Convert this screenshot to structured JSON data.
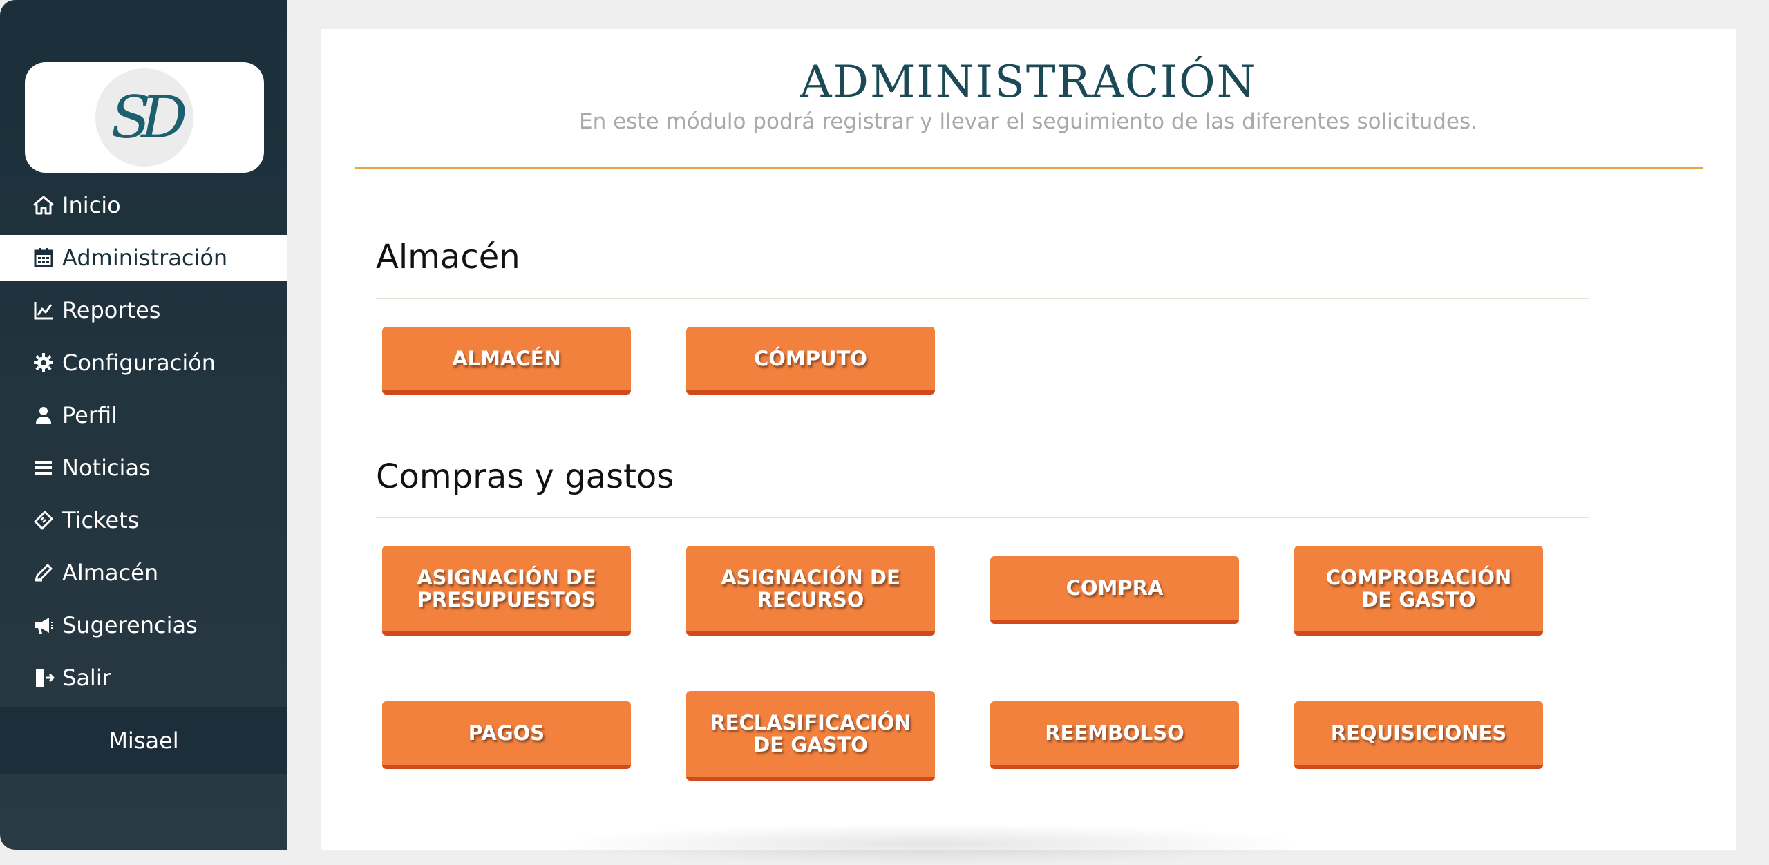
{
  "brand": {
    "logo_text": "SD"
  },
  "nav": {
    "items": [
      {
        "label": "Inicio",
        "icon": "home-icon"
      },
      {
        "label": "Administración",
        "icon": "calendar-icon",
        "active": true
      },
      {
        "label": "Reportes",
        "icon": "chart-line-icon"
      },
      {
        "label": "Configuración",
        "icon": "gear-icon"
      },
      {
        "label": "Perfil",
        "icon": "user-icon"
      },
      {
        "label": "Noticias",
        "icon": "list-icon"
      },
      {
        "label": "Tickets",
        "icon": "ticket-icon"
      },
      {
        "label": "Almacén",
        "icon": "pencil-icon"
      },
      {
        "label": "Sugerencias",
        "icon": "megaphone-icon"
      },
      {
        "label": "Salir",
        "icon": "logout-icon"
      }
    ]
  },
  "user": {
    "name": "Misael"
  },
  "page": {
    "title": "ADMINISTRACIÓN",
    "subtitle": "En este módulo podrá registrar y llevar el seguimiento de las diferentes solicitudes."
  },
  "sections": [
    {
      "title": "Almacén",
      "buttons": [
        "ALMACÉN",
        "CÓMPUTO"
      ]
    },
    {
      "title": "Compras y gastos",
      "buttons": [
        "ASIGNACIÓN DE PRESUPUESTOS",
        "ASIGNACIÓN DE RECURSO",
        "COMPRA",
        "COMPROBACIÓN DE GASTO",
        "PAGOS",
        "RECLASIFICACIÓN DE GASTO",
        "REEMBOLSO",
        "REQUISICIONES"
      ]
    }
  ],
  "colors": {
    "sidebar": "#1a2f3a",
    "accent_button": "#f2813e",
    "button_border": "#d04a1b",
    "title": "#1b4a56",
    "title_rule": "#e8a53b"
  }
}
